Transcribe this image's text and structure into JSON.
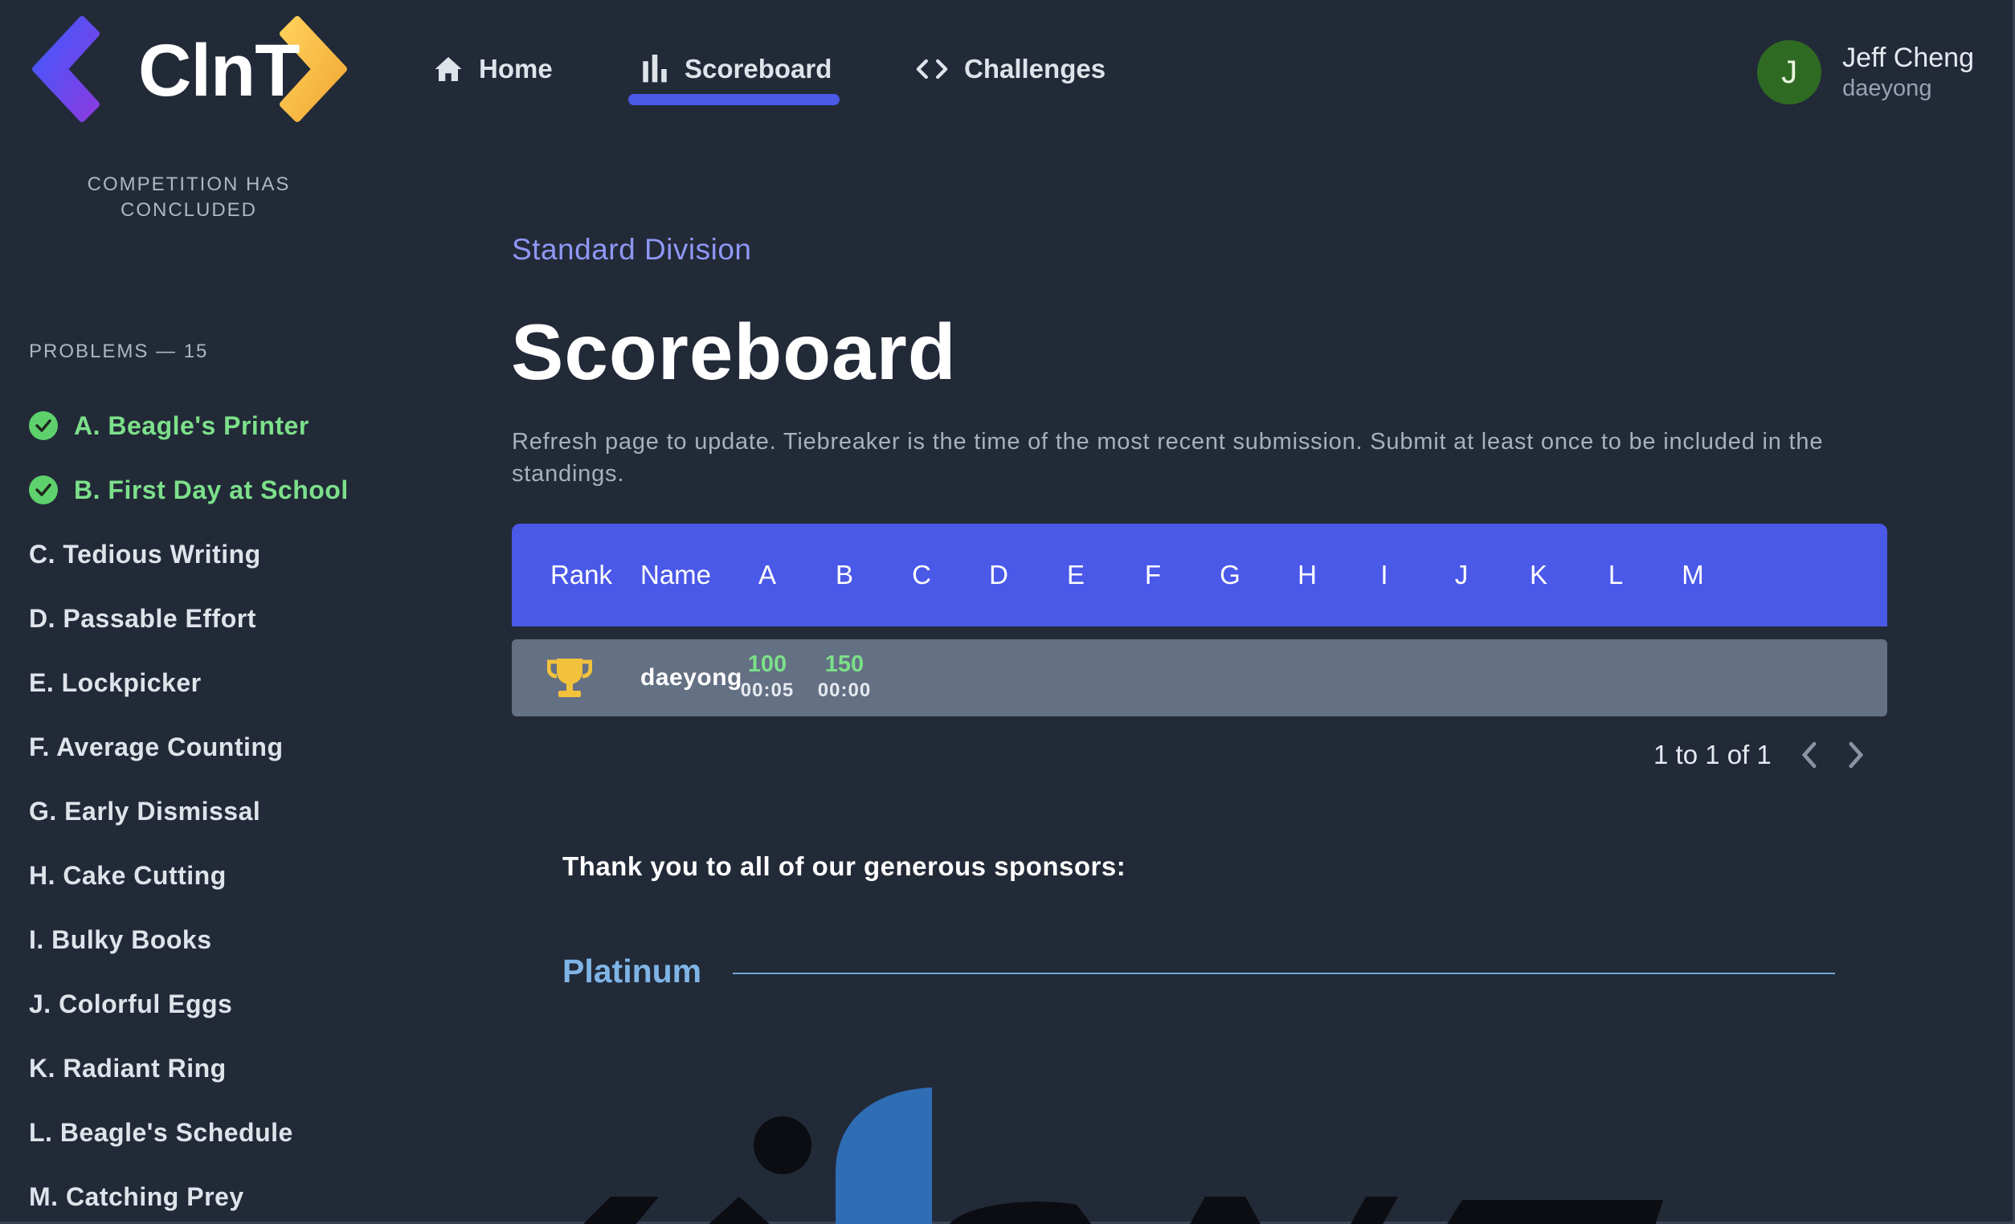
{
  "app": {
    "logo_text": "ClnT"
  },
  "nav": {
    "home": "Home",
    "scoreboard": "Scoreboard",
    "challenges": "Challenges",
    "active": "scoreboard"
  },
  "user": {
    "initial": "J",
    "name": "Jeff Cheng",
    "handle": "daeyong"
  },
  "sidebar": {
    "status": "COMPETITION HAS CONCLUDED",
    "problems_heading": "PROBLEMS — 15",
    "problems": [
      {
        "label": "A. Beagle's Printer",
        "solved": true
      },
      {
        "label": "B. First Day at School",
        "solved": true
      },
      {
        "label": "C. Tedious Writing",
        "solved": false
      },
      {
        "label": "D. Passable Effort",
        "solved": false
      },
      {
        "label": "E. Lockpicker",
        "solved": false
      },
      {
        "label": "F. Average Counting",
        "solved": false
      },
      {
        "label": "G. Early Dismissal",
        "solved": false
      },
      {
        "label": "H. Cake Cutting",
        "solved": false
      },
      {
        "label": "I. Bulky Books",
        "solved": false
      },
      {
        "label": "J. Colorful Eggs",
        "solved": false
      },
      {
        "label": "K. Radiant Ring",
        "solved": false
      },
      {
        "label": "L. Beagle's Schedule",
        "solved": false
      },
      {
        "label": "M. Catching Prey",
        "solved": false
      }
    ]
  },
  "main": {
    "division": "Standard Division",
    "title": "Scoreboard",
    "description": "Refresh page to update. Tiebreaker is the time of the most recent submission. Submit at least once to be included in the standings.",
    "table": {
      "rank_header": "Rank",
      "name_header": "Name",
      "problem_columns": [
        "A",
        "B",
        "C",
        "D",
        "E",
        "F",
        "G",
        "H",
        "I",
        "J",
        "K",
        "L",
        "M"
      ],
      "rows": [
        {
          "rank_icon": "trophy-icon",
          "name": "daeyong",
          "scores": [
            {
              "problem": "A",
              "points": "100",
              "time": "00:05"
            },
            {
              "problem": "B",
              "points": "150",
              "time": "00:00"
            }
          ]
        }
      ]
    },
    "pagination": {
      "text": "1 to 1 of 1"
    },
    "sponsors": {
      "thanks": "Thank you to all of our generous sponsors:",
      "tier": "Platinum"
    }
  },
  "colors": {
    "background": "#222a38",
    "accent": "#4a59e8",
    "solved": "#7ce08a",
    "row": "#647083",
    "tier": "#7fb5e6"
  }
}
